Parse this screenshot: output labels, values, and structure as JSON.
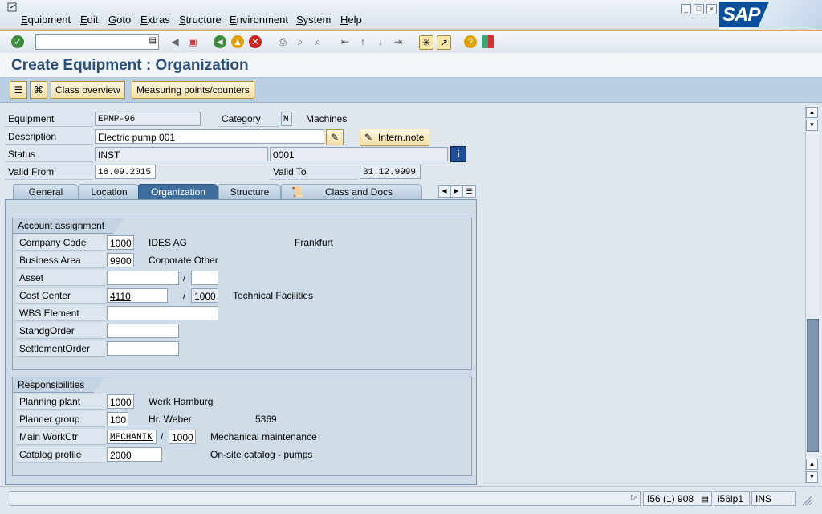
{
  "menu": {
    "items": [
      "Equipment",
      "Edit",
      "Goto",
      "Extras",
      "Structure",
      "Environment",
      "System",
      "Help"
    ]
  },
  "logo": {
    "text": "SAP"
  },
  "toolbar": {
    "command_field_value": "",
    "icons": [
      "enter-icon",
      "back-icon",
      "save-icon",
      "back-nav-icon",
      "exit-icon",
      "cancel-icon",
      "print-icon",
      "find-icon",
      "find-next-icon",
      "first-page-icon",
      "prev-page-icon",
      "next-page-icon",
      "last-page-icon",
      "new-session-icon",
      "shortcut-icon",
      "help-icon",
      "layout-icon"
    ]
  },
  "title": "Create Equipment : Organization",
  "app_toolbar": {
    "class_overview": "Class overview",
    "measuring_points": "Measuring points/counters"
  },
  "header": {
    "equipment_label": "Equipment",
    "equipment_value": "EPMP-96",
    "category_label": "Category",
    "category_value": "M",
    "category_text": "Machines",
    "description_label": "Description",
    "description_value": "Electric pump 001",
    "intern_note": "Intern.note",
    "status_label": "Status",
    "status_value": "INST",
    "status_value2": "0001",
    "valid_from_label": "Valid From",
    "valid_from_value": "18.09.2015",
    "valid_to_label": "Valid To",
    "valid_to_value": "31.12.9999"
  },
  "tabs": [
    {
      "label": "General",
      "active": false
    },
    {
      "label": "Location",
      "active": false
    },
    {
      "label": "Organization",
      "active": true
    },
    {
      "label": "Structure",
      "active": false
    },
    {
      "label": "Class and Docs",
      "active": false
    }
  ],
  "account_assignment": {
    "title": "Account assignment",
    "company_code_label": "Company Code",
    "company_code_value": "1000",
    "company_code_text": "IDES AG",
    "company_code_city": "Frankfurt",
    "business_area_label": "Business Area",
    "business_area_value": "9900",
    "business_area_text": "Corporate Other",
    "asset_label": "Asset",
    "asset_value": "",
    "asset_sub_value": "",
    "cost_center_label": "Cost Center",
    "cost_center_value": "4110",
    "cost_center_area": "1000",
    "cost_center_text": "Technical Facilities",
    "wbs_label": "WBS Element",
    "wbs_value": "",
    "standg_label": "StandgOrder",
    "standg_value": "",
    "settlement_label": "SettlementOrder",
    "settlement_value": ""
  },
  "responsibilities": {
    "title": "Responsibilities",
    "planning_plant_label": "Planning plant",
    "planning_plant_value": "1000",
    "planning_plant_text": "Werk Hamburg",
    "planner_group_label": "Planner group",
    "planner_group_value": "100",
    "planner_group_text": "Hr. Weber",
    "planner_group_phone": "5369",
    "workctr_label": "Main WorkCtr",
    "workctr_value": "MECHANIK",
    "workctr_plant": "1000",
    "workctr_text": "Mechanical maintenance",
    "catalog_label": "Catalog profile",
    "catalog_value": "2000",
    "catalog_text": "On-site catalog - pumps"
  },
  "statusbar": {
    "system": "I56 (1) 908",
    "server": "i56lp1",
    "mode": "INS"
  },
  "colors": {
    "title_text": "#2a4f7c",
    "active_tab": "#3e6e9e",
    "button_bg": "#f2dfa8",
    "toolbar_accent": "#e8a33d"
  }
}
